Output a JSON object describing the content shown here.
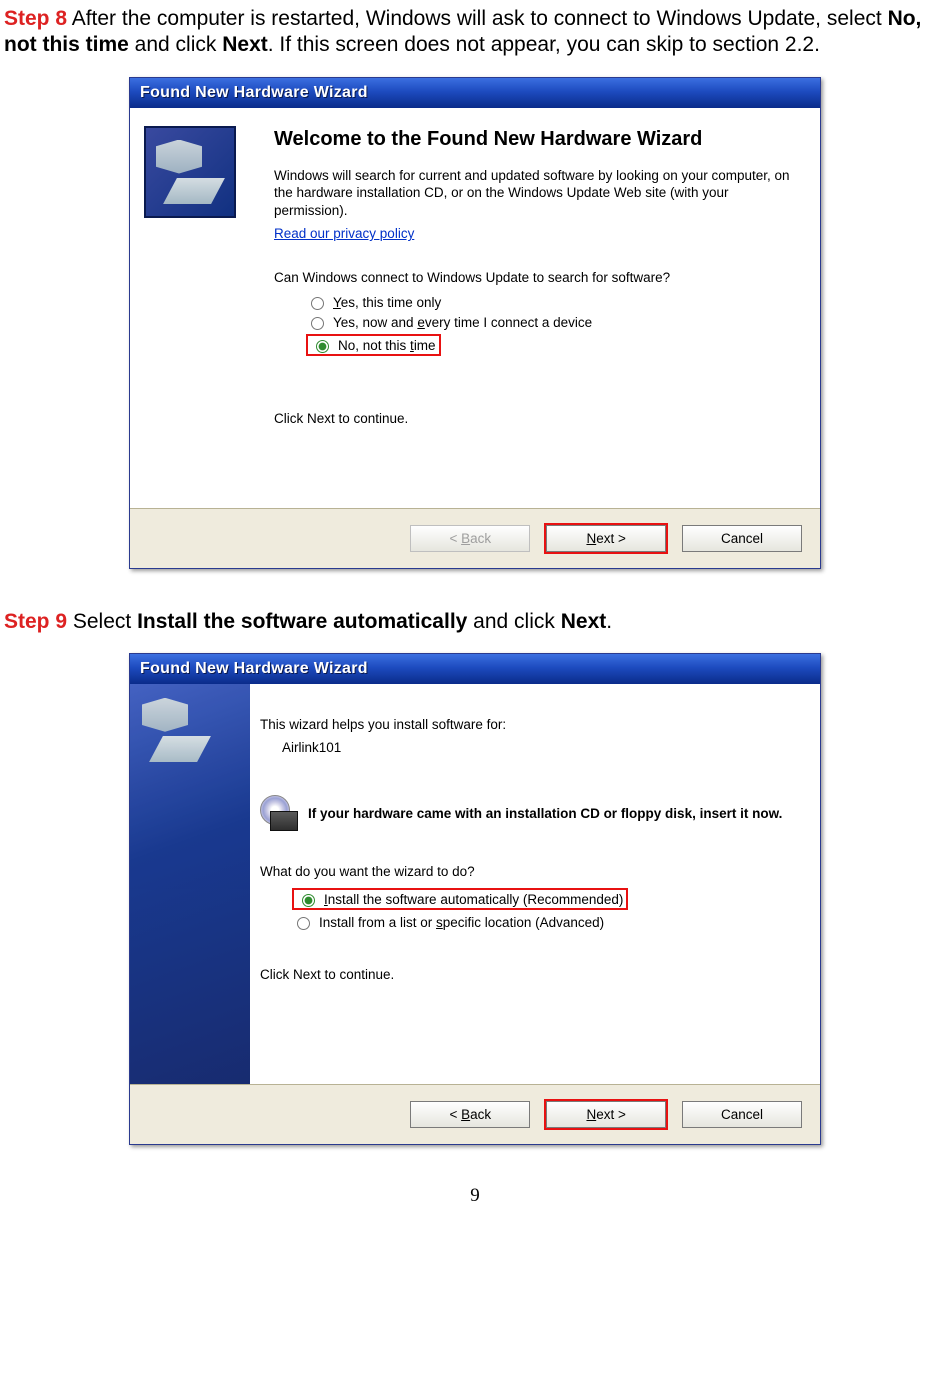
{
  "step8": {
    "label": "Step 8",
    "text_before": " After the computer is restarted, Windows will ask to connect to Windows Update, select ",
    "bold1": "No, not this time",
    "mid1": " and click ",
    "bold2": "Next",
    "after": ". If this screen does not appear, you can skip to section 2.2."
  },
  "dlg1": {
    "title": "Found New Hardware Wizard",
    "heading": "Welcome to the Found New Hardware Wizard",
    "para1": "Windows will search for current and updated software by looking on your computer, on the hardware installation CD, or on the Windows Update Web site (with your permission).",
    "privacy": "Read our privacy policy",
    "question": "Can Windows connect to Windows Update to search for software?",
    "opt1": "Yes, this time only",
    "opt2": "Yes, now and every time I connect a device",
    "opt3": "No, not this time",
    "continue": "Click Next to continue.",
    "back": "< Back",
    "next": "Next >",
    "cancel": "Cancel"
  },
  "step9": {
    "label": "Step 9",
    "text_before": " Select ",
    "bold1": "Install the software automatically",
    "mid1": " and click ",
    "bold2": "Next",
    "after": "."
  },
  "dlg2": {
    "title": "Found New Hardware Wizard",
    "para1": "This wizard helps you install software for:",
    "device": "Airlink101",
    "cd_text": "If your hardware came with an installation CD or floppy disk, insert it now.",
    "question": "What do you want the wizard to do?",
    "opt1": "Install the software automatically (Recommended)",
    "opt2": "Install from a list or specific location (Advanced)",
    "continue": "Click Next to continue.",
    "back": "< Back",
    "next": "Next >",
    "cancel": "Cancel"
  },
  "page_number": "9"
}
